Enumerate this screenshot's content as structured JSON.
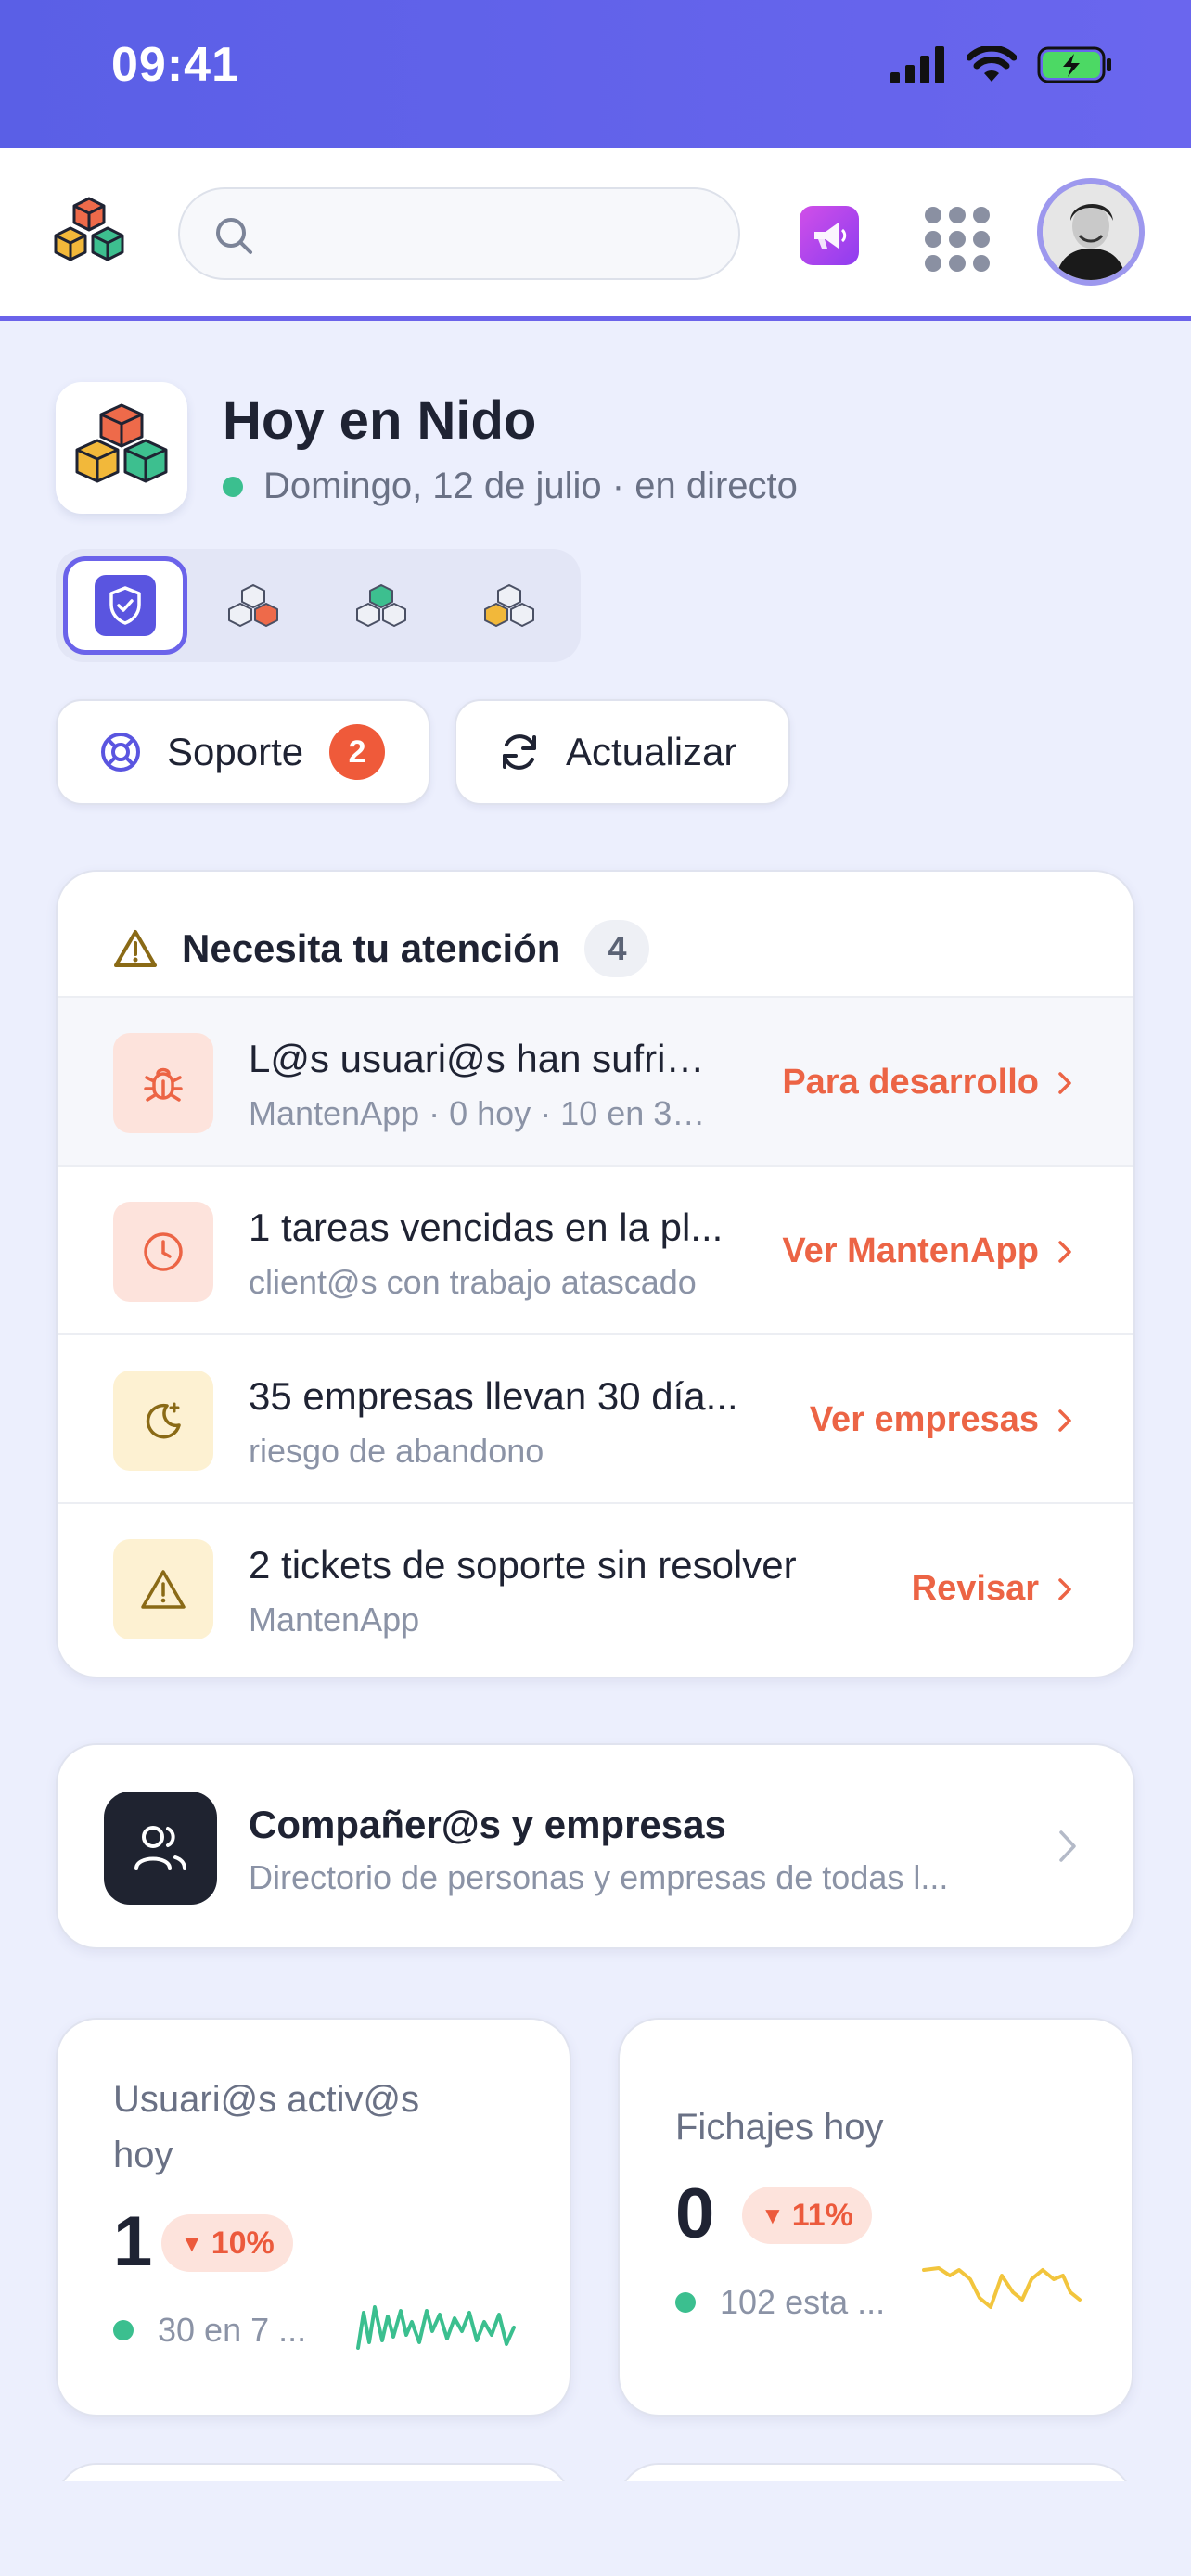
{
  "status_bar": {
    "time": "09:41"
  },
  "app_bar": {
    "search_placeholder": "",
    "megaphone_icon": "megaphone-icon",
    "apps_icon": "grid-icon"
  },
  "header": {
    "title": "Hoy en Nido",
    "subtitle": "Domingo, 12 de julio · en directo"
  },
  "actions": {
    "support_label": "Soporte",
    "support_badge": "2",
    "refresh_label": "Actualizar"
  },
  "attention": {
    "title": "Necesita tu atención",
    "count": "4",
    "items": [
      {
        "title": "L@s usuari@s han sufrid...",
        "subtitle": "MantenApp · 0 hoy · 10 en 30 ...",
        "action": "Para desarrollo",
        "icon": "bug-icon",
        "tone": "red"
      },
      {
        "title": "1 tareas vencidas en la pl...",
        "subtitle": "client@s con trabajo atascado",
        "action": "Ver MantenApp",
        "icon": "clock-icon",
        "tone": "red"
      },
      {
        "title": "35 empresas llevan 30 día...",
        "subtitle": "riesgo de abandono",
        "action": "Ver empresas",
        "icon": "moon-icon",
        "tone": "yellow"
      },
      {
        "title": "2 tickets de soporte sin resolver",
        "subtitle": "MantenApp",
        "action": "Revisar",
        "icon": "warning-icon",
        "tone": "yellow"
      }
    ]
  },
  "directory": {
    "title": "Compañer@s y empresas",
    "subtitle": "Directorio de personas y empresas de todas l..."
  },
  "stats": [
    {
      "label_line1": "Usuari@s activ@s",
      "label_line2": "hoy",
      "value": "1",
      "delta": "10%",
      "footer": "30 en 7 ...",
      "spark_color": "#3bbf8f"
    },
    {
      "label_line1": "Fichajes hoy",
      "value": "0",
      "delta": "11%",
      "footer": "102 esta ...",
      "spark_color": "#f2c53d"
    }
  ],
  "colors": {
    "accent": "#6b63ea",
    "danger": "#ec6445",
    "success": "#3bbf8f"
  }
}
